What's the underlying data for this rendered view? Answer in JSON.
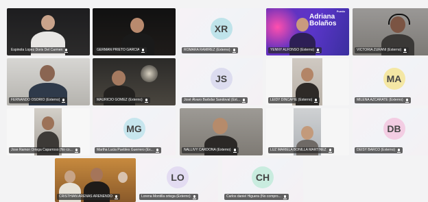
{
  "participants": [
    {
      "name": "Espinola Lopez Doris Del Carmen",
      "type": "video",
      "tone": "dark"
    },
    {
      "name": "GERMAN PRIETO GARCIA",
      "type": "video",
      "tone": "dark"
    },
    {
      "name": "ROMARA RAMIREZ (Externo)",
      "type": "avatar",
      "initials": "XR",
      "color": "#bfe3ea"
    },
    {
      "name": "YENNY ALFONSO (Externo)",
      "type": "video",
      "tone": "banner"
    },
    {
      "name": "VICTORIA ZURANI (Externo)",
      "type": "video",
      "tone": "gray"
    },
    {
      "name": "FERNANDO OSORIO (Externo)",
      "type": "video",
      "tone": "gray"
    },
    {
      "name": "MAURICIO GOMEZ (Externo)",
      "type": "video",
      "tone": "dark"
    },
    {
      "name": "José Álvaro Barbdar Sandoval (Ext...",
      "type": "avatar",
      "initials": "JS",
      "color": "#dcdcef"
    },
    {
      "name": "LEIDY DINCAPIE (Externo)",
      "type": "video",
      "tone": "light"
    },
    {
      "name": "MILENA AZCARATE (Externo)",
      "type": "avatar",
      "initials": "MA",
      "color": "#f4e7a4"
    },
    {
      "name": "Jose Ramon Ortega Caparroso (No co...",
      "type": "video",
      "tone": "light"
    },
    {
      "name": "Martha Lucia Puebles Guerrero (Ex...",
      "type": "avatar",
      "initials": "MG",
      "color": "#c7e6ee"
    },
    {
      "name": "NALLIVY CARDONA (Externo)",
      "type": "video",
      "tone": "gray"
    },
    {
      "name": "LUZ MARIELA BONILLA MARTINEZ",
      "type": "video",
      "tone": "light"
    },
    {
      "name": "DEISY BARCO (Externo)",
      "type": "avatar",
      "initials": "DB",
      "color": "#f3cde3"
    },
    {
      "name": "CRISTHIAN ARENAS ARENENDO",
      "type": "video",
      "tone": "warm"
    },
    {
      "name": "Lorena Montilla ortega (Externo)",
      "type": "avatar",
      "initials": "LO",
      "color": "#e3dcf2"
    },
    {
      "name": "Carlos daniel Higuera (No compro...",
      "type": "avatar",
      "initials": "CH",
      "color": "#c9ecdf"
    }
  ],
  "banner": {
    "title": "Adriana Bolaños",
    "logo": "Puedo"
  },
  "colors": {
    "background": "#f3f3f4",
    "namebar": "#282828"
  }
}
